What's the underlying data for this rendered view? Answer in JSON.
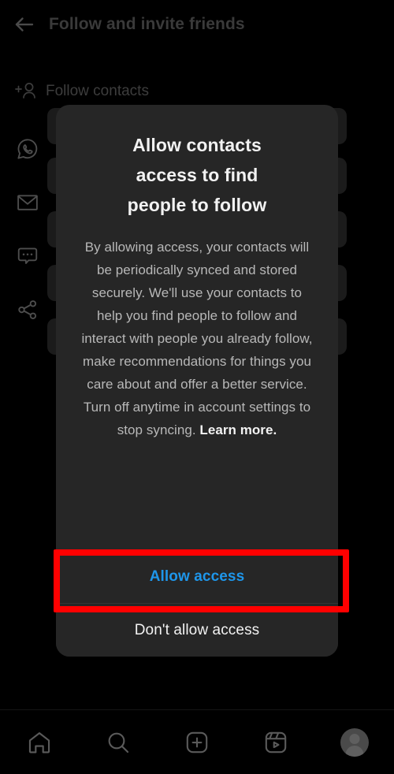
{
  "header": {
    "back_icon": "back-arrow-icon",
    "title": "Follow and invite friends"
  },
  "background": {
    "section": {
      "icon": "person-add-icon",
      "label": "Follow contacts"
    },
    "share_options": [
      {
        "icon": "whatsapp-icon",
        "name": "whatsapp"
      },
      {
        "icon": "email-icon",
        "name": "email"
      },
      {
        "icon": "message-icon",
        "name": "message"
      },
      {
        "icon": "share-icon",
        "name": "share"
      }
    ]
  },
  "dialog": {
    "title": "Allow contacts access to find people to follow",
    "body": "By allowing access, your contacts will be periodically synced and stored securely. We'll use your contacts to help you find people to follow and interact with people you already follow, make recommendations for things you care about and offer a better service. Turn off anytime in account settings to stop syncing. ",
    "learn_more": "Learn more.",
    "primary_action": "Allow access",
    "secondary_action": "Don't allow access",
    "primary_color": "#1e96ea",
    "surface_color": "#262626"
  },
  "annotation": {
    "name": "highlight-box",
    "color": "#ff0000",
    "target": "Allow access"
  },
  "bottom_nav": {
    "items": [
      {
        "icon": "home-icon",
        "name": "home"
      },
      {
        "icon": "search-icon",
        "name": "search"
      },
      {
        "icon": "create-plus-icon",
        "name": "create"
      },
      {
        "icon": "reels-icon",
        "name": "reels"
      },
      {
        "icon": "profile-avatar-icon",
        "name": "profile"
      }
    ]
  }
}
